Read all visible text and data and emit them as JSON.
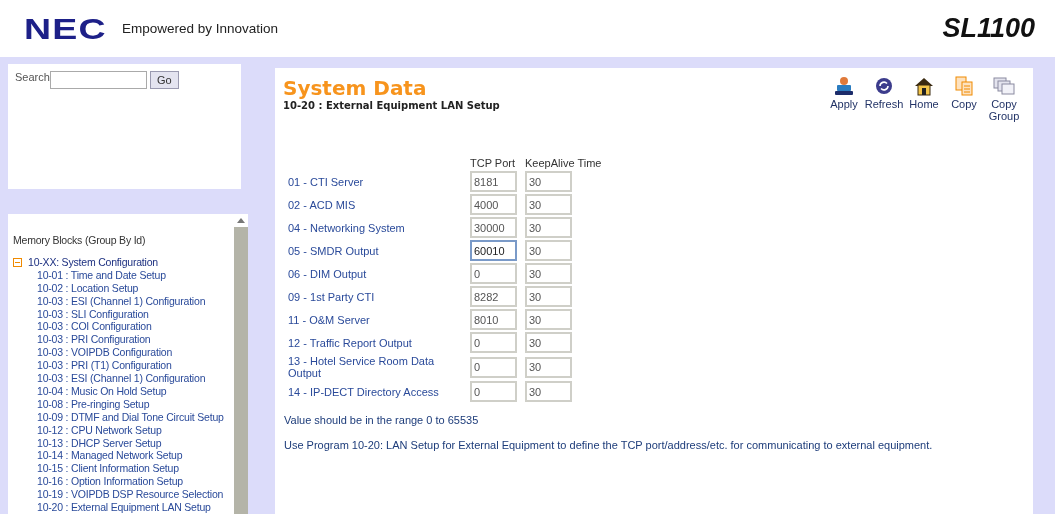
{
  "header": {
    "logo": "NEC",
    "tagline": "Empowered by Innovation",
    "product": "SL1100"
  },
  "search": {
    "label": "Search",
    "button": "Go"
  },
  "tree": {
    "title": "Memory Blocks (Group By Id)",
    "groups": [
      {
        "label": "10-XX: System Configuration",
        "expanded": true,
        "children": [
          {
            "label": "10-01 : Time and Date Setup"
          },
          {
            "label": "10-02 : Location Setup"
          },
          {
            "label": "10-03 : ESI (Channel 1) Configuration"
          },
          {
            "label": "10-03 : SLI Configuration"
          },
          {
            "label": "10-03 : COI Configuration"
          },
          {
            "label": "10-03 : PRI Configuration"
          },
          {
            "label": "10-03 : VOIPDB Configuration"
          },
          {
            "label": "10-03 : PRI (T1) Configuration"
          },
          {
            "label": "10-03 : ESI (Channel 1) Configuration"
          },
          {
            "label": "10-04 : Music On Hold Setup"
          },
          {
            "label": "10-08 : Pre-ringing Setup"
          },
          {
            "label": "10-09 : DTMF and Dial Tone Circuit Setup"
          },
          {
            "label": "10-12 : CPU Network Setup"
          },
          {
            "label": "10-13 : DHCP Server Setup"
          },
          {
            "label": "10-14 : Managed Network Setup"
          },
          {
            "label": "10-15 : Client Information Setup"
          },
          {
            "label": "10-16 : Option Information Setup"
          },
          {
            "label": "10-19 : VOIPDB DSP Resource Selection"
          },
          {
            "label": "10-20 : External Equipment LAN Setup"
          }
        ]
      }
    ]
  },
  "main": {
    "title": "System Data",
    "subtitle": "10-20 : External Equipment LAN Setup",
    "toolbar": [
      {
        "kind": "apply",
        "label": "Apply"
      },
      {
        "kind": "refresh",
        "label": "Refresh"
      },
      {
        "kind": "home",
        "label": "Home"
      },
      {
        "kind": "copy",
        "label": "Copy"
      },
      {
        "kind": "copygroup",
        "label": "Copy Group"
      }
    ],
    "columns": [
      "TCP Port",
      "KeepAlive Time"
    ],
    "rows": [
      {
        "label": "01 - CTI Server",
        "tcp_port": "8181",
        "keepalive": "30",
        "focused": false
      },
      {
        "label": "02 - ACD MIS",
        "tcp_port": "4000",
        "keepalive": "30",
        "focused": false
      },
      {
        "label": "04 - Networking System",
        "tcp_port": "30000",
        "keepalive": "30",
        "focused": false
      },
      {
        "label": "05 - SMDR Output",
        "tcp_port": "60010",
        "keepalive": "30",
        "focused": true
      },
      {
        "label": "06 - DIM Output",
        "tcp_port": "0",
        "keepalive": "30",
        "focused": false
      },
      {
        "label": "09 - 1st Party CTI",
        "tcp_port": "8282",
        "keepalive": "30",
        "focused": false
      },
      {
        "label": "11 - O&M Server",
        "tcp_port": "8010",
        "keepalive": "30",
        "focused": false
      },
      {
        "label": "12 - Traffic Report Output",
        "tcp_port": "0",
        "keepalive": "30",
        "focused": false
      },
      {
        "label": "13 - Hotel Service Room Data Output",
        "tcp_port": "0",
        "keepalive": "30",
        "focused": false
      },
      {
        "label": "14 - IP-DECT Directory Access",
        "tcp_port": "0",
        "keepalive": "30",
        "focused": false
      }
    ],
    "range_note": "Value should be in the range 0 to 65535",
    "help": "Use Program 10-20: LAN Setup for External Equipment to define the TCP port/address/etc. for communicating to external equipment."
  }
}
